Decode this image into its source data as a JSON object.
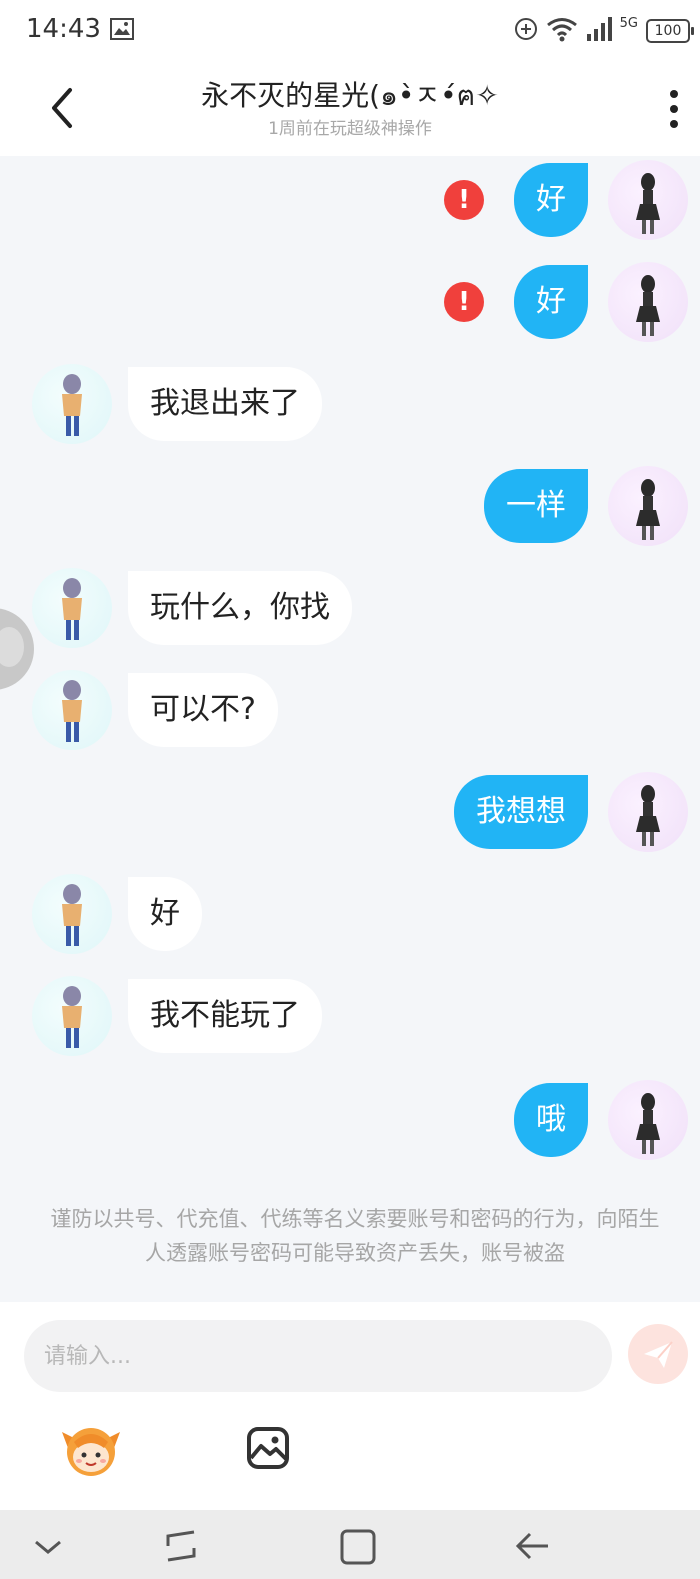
{
  "status_bar": {
    "time": "14:43",
    "network": "5G",
    "battery": "100",
    "icons": [
      "gallery-icon",
      "add-circle-icon",
      "wifi-icon",
      "signal-icon",
      "battery-icon"
    ]
  },
  "header": {
    "title": "永不灭的星光(๑•̀ㅈ•́ฅ✧",
    "subtitle": "1周前在玩超级神操作",
    "back_icon": "back-arrow-icon",
    "more_icon": "more-vertical-icon"
  },
  "messages": [
    {
      "sender": "me",
      "text": "好",
      "failed": true
    },
    {
      "sender": "me",
      "text": "好",
      "failed": true
    },
    {
      "sender": "them",
      "text": "我退出来了"
    },
    {
      "sender": "me",
      "text": "一样"
    },
    {
      "sender": "them",
      "text": "玩什么，你找"
    },
    {
      "sender": "them",
      "text": "可以不?"
    },
    {
      "sender": "me",
      "text": "我想想"
    },
    {
      "sender": "them",
      "text": "好"
    },
    {
      "sender": "them",
      "text": "我不能玩了"
    },
    {
      "sender": "me",
      "text": "哦"
    }
  ],
  "error_mark": "!",
  "notice": "谨防以共号、代充值、代练等名义索要账号和密码的行为，向陌生人透露账号密码可能导致资产丢失，账号被盗",
  "input": {
    "placeholder": "请输入...",
    "value": ""
  },
  "toolbar": {
    "send_icon": "send-icon",
    "emoji_icon": "emoji-mascot-icon",
    "image_icon": "image-icon"
  },
  "colors": {
    "my_bubble": "#21b4f5",
    "their_bubble": "#ffffff",
    "error": "#f0403c",
    "background": "#f4f6f9"
  },
  "nav_bar": {
    "items": [
      "chevron-down-icon",
      "recent-apps-icon",
      "home-icon",
      "back-icon"
    ]
  }
}
